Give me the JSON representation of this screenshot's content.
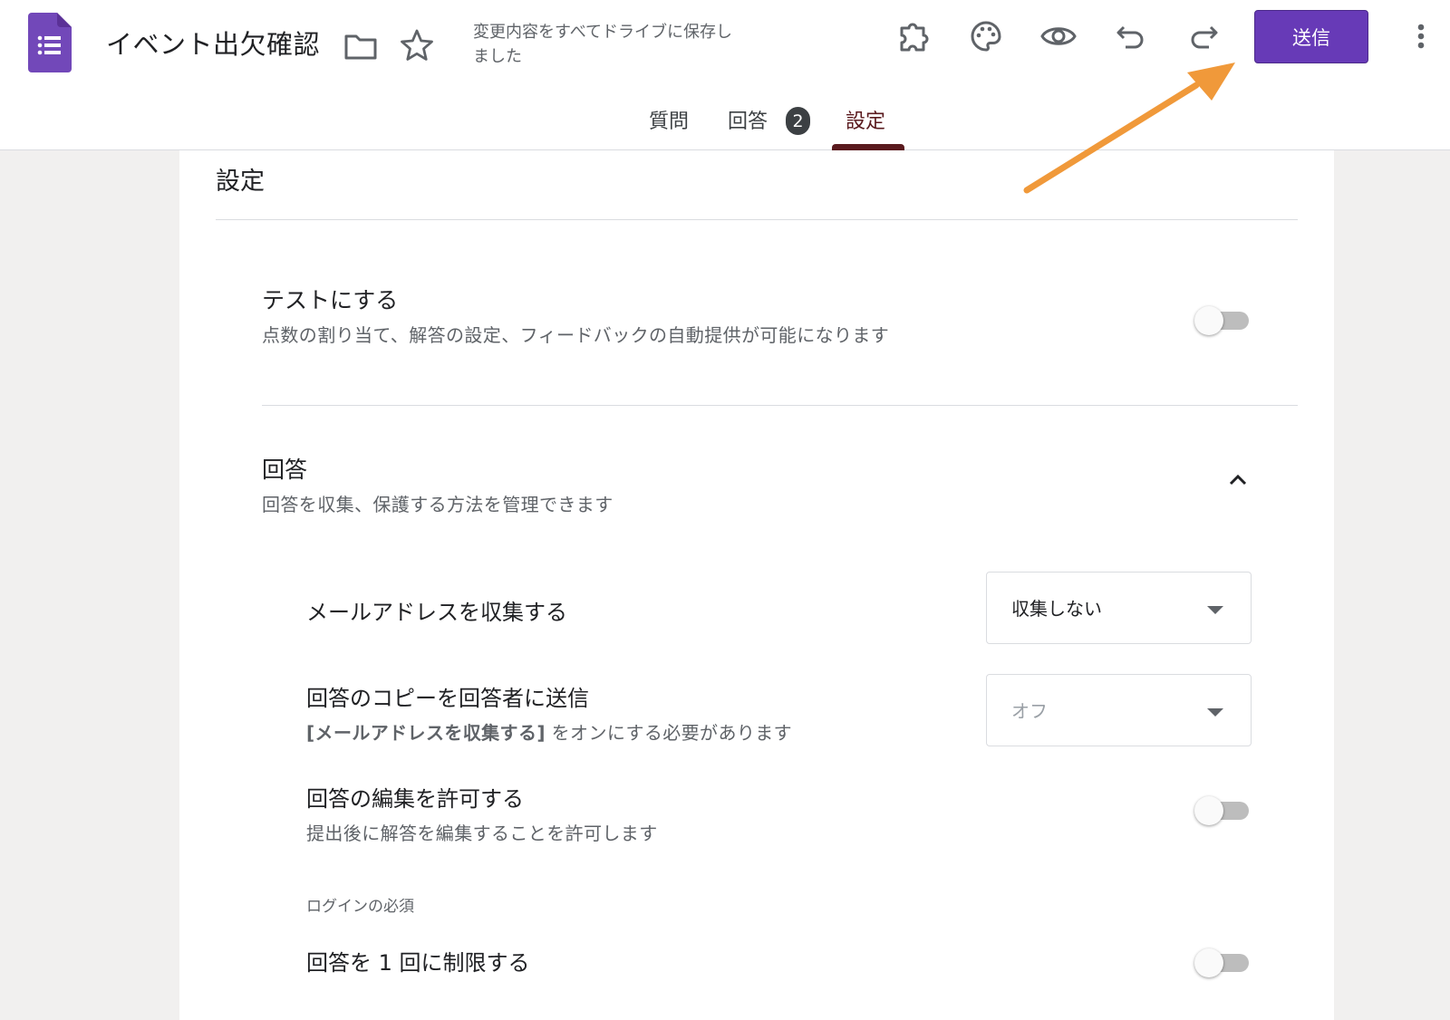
{
  "header": {
    "form_title": "イベント出欠確認",
    "save_status": "変更内容をすべてドライブに保存しました",
    "send_label": "送信"
  },
  "tabs": {
    "questions": "質問",
    "responses": "回答",
    "responses_count": "2",
    "settings": "設定",
    "active": "settings"
  },
  "icons": {
    "app": "forms-doc-icon",
    "folder": "folder-icon",
    "star": "star-icon",
    "addons": "puzzle-icon",
    "theme": "palette-icon",
    "preview": "eye-icon",
    "undo": "undo-icon",
    "redo": "redo-icon",
    "more": "more-vert-icon"
  },
  "settings": {
    "heading": "設定",
    "quiz": {
      "title": "テストにする",
      "description": "点数の割り当て、解答の設定、フィードバックの自動提供が可能になります",
      "enabled": false
    },
    "responses": {
      "title": "回答",
      "description": "回答を収集、保護する方法を管理できます",
      "expanded": true,
      "collect_email": {
        "title": "メールアドレスを収集する",
        "selected": "収集しない"
      },
      "send_copy": {
        "title": "回答のコピーを回答者に送信",
        "desc_strong": "[メールアドレスを収集する]",
        "desc_rest": " をオンにする必要があります",
        "selected": "オフ",
        "disabled": true
      },
      "allow_edit": {
        "title": "回答の編集を許可する",
        "description": "提出後に解答を編集することを許可します",
        "enabled": false
      },
      "login_section_label": "ログインの必須",
      "limit_one": {
        "title": "回答を 1 回に制限する",
        "enabled": false
      }
    }
  },
  "colors": {
    "brand_purple": "#673ab7",
    "active_tab": "#5a1a1e",
    "annotation_arrow": "#f0993a"
  }
}
